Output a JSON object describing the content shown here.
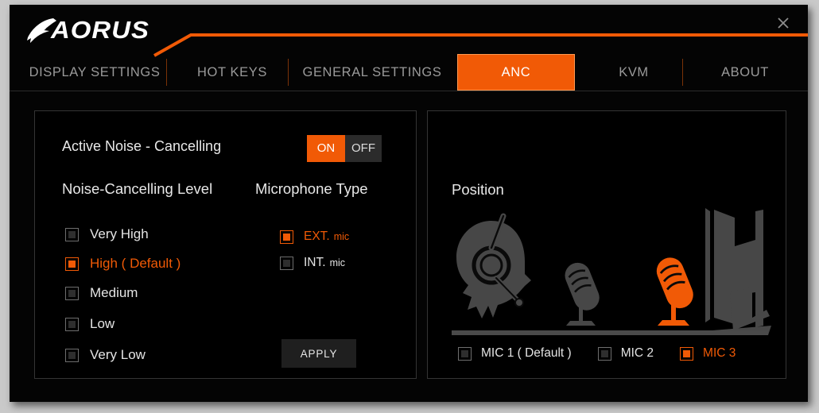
{
  "window": {
    "brand": "AORUS",
    "close_label": "close-icon"
  },
  "tabs": [
    {
      "label": "DISPLAY SETTINGS",
      "active": false
    },
    {
      "label": "HOT KEYS",
      "active": false
    },
    {
      "label": "GENERAL SETTINGS",
      "active": false
    },
    {
      "label": "ANC",
      "active": true
    },
    {
      "label": "KVM",
      "active": false
    },
    {
      "label": "ABOUT",
      "active": false
    }
  ],
  "left_panel": {
    "anc_label": "Active Noise - Cancelling",
    "toggle": {
      "on": "ON",
      "off": "OFF",
      "state": "ON"
    },
    "noise_level_title": "Noise-Cancelling Level",
    "noise_levels": [
      {
        "label": "Very High",
        "selected": false
      },
      {
        "label": "High ( Default )",
        "selected": true
      },
      {
        "label": "Medium",
        "selected": false
      },
      {
        "label": "Low",
        "selected": false
      },
      {
        "label": "Very Low",
        "selected": false
      }
    ],
    "mic_type_title": "Microphone Type",
    "mic_types": [
      {
        "label": "EXT.",
        "sub": "mic",
        "selected": true
      },
      {
        "label": "INT.",
        "sub": "mic",
        "selected": false
      }
    ],
    "apply_label": "APPLY"
  },
  "right_panel": {
    "position_title": "Position",
    "mic_positions": [
      {
        "label": "MIC 1 ( Default )",
        "selected": false
      },
      {
        "label": "MIC 2",
        "selected": false
      },
      {
        "label": "MIC 3",
        "selected": true
      }
    ]
  },
  "colors": {
    "accent": "#f15a06",
    "panel_border": "#343434",
    "text": "#e8e8e8",
    "muted_text": "#9a9a9a",
    "illustration_gray": "#474747"
  }
}
